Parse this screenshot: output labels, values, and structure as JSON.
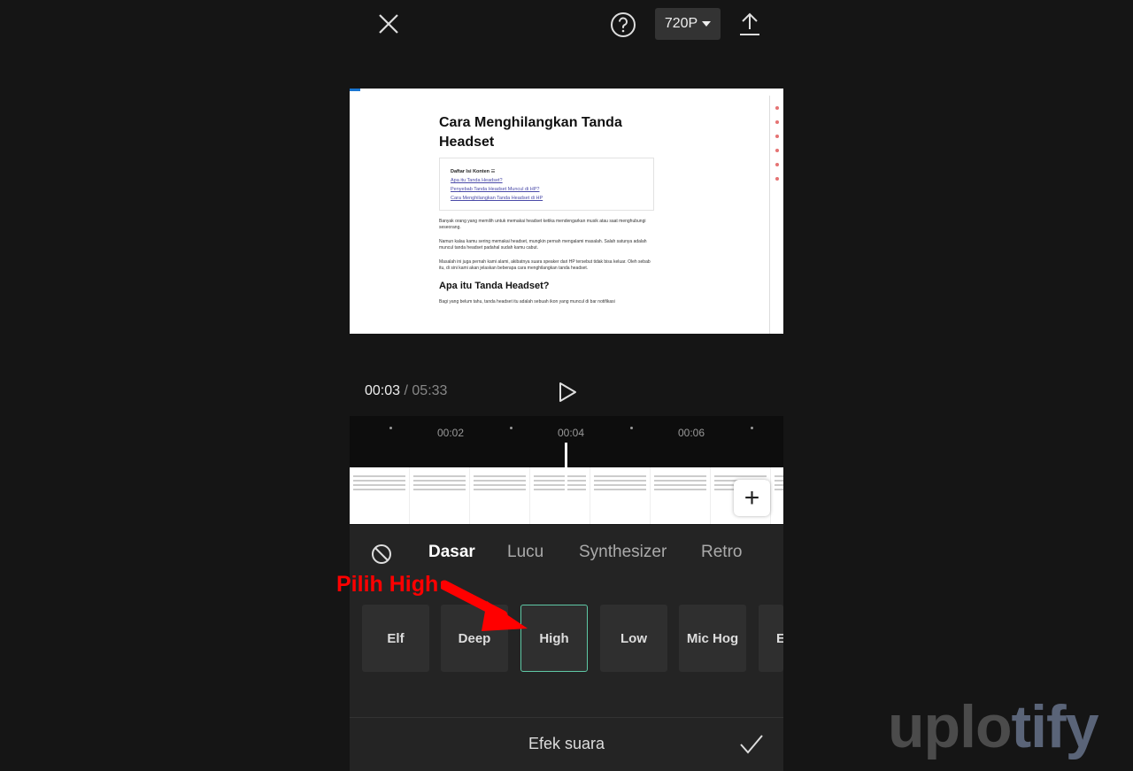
{
  "topbar": {
    "resolution": "720P",
    "icons": [
      "close-icon",
      "help-icon",
      "export-icon"
    ]
  },
  "preview": {
    "title": "Cara Menghilangkan Tanda Headset",
    "toc_title": "Daftar Isi Konten",
    "toc_links": [
      "Apa itu Tanda Headset?",
      "Penyebab Tanda Headset Muncul di HP?",
      "Cara Menghilangkan Tanda Headset di HP"
    ],
    "paragraphs": [
      "Banyak orang yang memilih untuk memakai headset ketika mendengarkan musik atau saat menghubungi seseorang.",
      "Namun kalau kamu sering memakai headset, mungkin pernah mengalami masalah. Salah satunya adalah muncul tanda headset padahal sudah kamu cabut.",
      "Masalah ini juga pernah kami alami, akibatnya suara speaker dari HP tersebut tidak bisa keluar. Oleh sebab itu, di sini kami akan jelaskan beberapa cara menghilangkan tanda headset."
    ],
    "heading2": "Apa itu Tanda Headset?",
    "paragraph_last": "Bagi yang belum tahu, tanda headset itu adalah sebuah ikon yang muncul di bar notifikasi"
  },
  "player": {
    "current": "00:03",
    "separator": " / ",
    "total": "05:33"
  },
  "timeline": {
    "ticks": [
      "00:02",
      "00:04",
      "00:06"
    ]
  },
  "tabs": [
    "Dasar",
    "Lucu",
    "Synthesizer",
    "Retro"
  ],
  "active_tab": "Dasar",
  "effects": [
    "Elf",
    "Deep",
    "High",
    "Low",
    "Mic Hog",
    "E"
  ],
  "selected_effect": "High",
  "footer": {
    "title": "Efek suara"
  },
  "annotation": "Pilih High",
  "watermark": {
    "part1": "uplo",
    "part2": "tify"
  },
  "colors": {
    "accent": "#5fc9a6",
    "annotation": "#ff0000",
    "panel": "#242424"
  }
}
